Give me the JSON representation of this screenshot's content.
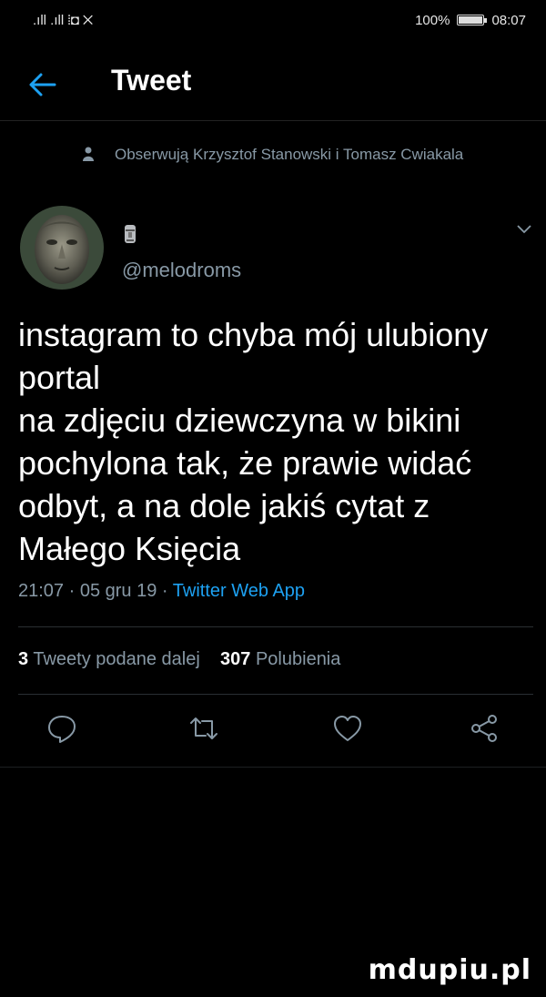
{
  "status_bar": {
    "left_indicators": ".ıll .ıll ⦙◘ ✕",
    "battery_label": "100%",
    "battery_level": 1.0,
    "time": "08:07"
  },
  "header": {
    "back_icon": "arrow-left-icon",
    "title": "Tweet"
  },
  "social_context": {
    "icon": "person-icon",
    "text": "Obserwują Krzysztof Stanowski i Tomasz Cwiakala"
  },
  "author": {
    "handle": "@melodroms",
    "name_icon": "moai-emoji-icon"
  },
  "tweet": {
    "text": "instagram to chyba mój ulubiony portal\nna zdjęciu dziewczyna w bikini pochylona tak, że prawie widać odbyt, a na dole jakiś cytat z Małego Księcia",
    "time": "21:07",
    "date": "05 gru 19",
    "source": "Twitter Web App"
  },
  "stats": {
    "retweets_count": "3",
    "retweets_label": "Tweety podane dalej",
    "likes_count": "307",
    "likes_label": "Polubienia"
  },
  "actions": {
    "reply_icon": "reply-icon",
    "retweet_icon": "retweet-icon",
    "like_icon": "heart-icon",
    "share_icon": "share-icon"
  },
  "colors": {
    "background": "#000000",
    "secondary_text": "#8899a6",
    "accent": "#1da1f2"
  },
  "watermark": "mdupiu.pl"
}
